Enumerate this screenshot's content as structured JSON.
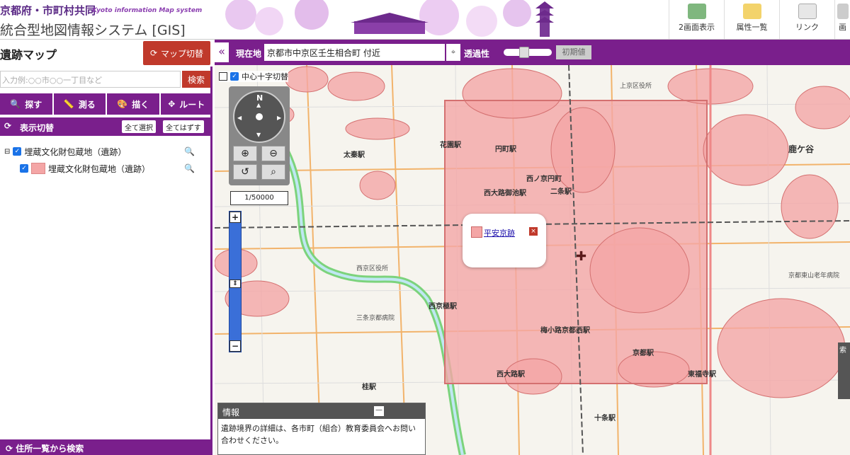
{
  "header": {
    "org": "京都府・市町村共同",
    "org_en": "Kyoto information Map system",
    "system_title": "統合型地図情報システム [GIS]",
    "buttons": [
      {
        "label": "2画面表示",
        "icon": "split-screen-icon"
      },
      {
        "label": "属性一覧",
        "icon": "document-list-icon"
      },
      {
        "label": "リンク",
        "icon": "link-envelope-icon"
      },
      {
        "label": "画",
        "icon": "print-icon"
      }
    ]
  },
  "left_panel": {
    "title": "遺跡マップ",
    "map_switch_label": "マップ切替",
    "search_placeholder": "入力例:○○市○○一丁目など",
    "search_button": "検索",
    "tools": [
      {
        "label": "探す",
        "icon": "search-icon"
      },
      {
        "label": "測る",
        "icon": "ruler-icon"
      },
      {
        "label": "描く",
        "icon": "palette-icon"
      },
      {
        "label": "ルート",
        "icon": "route-icon"
      }
    ],
    "display_switch": {
      "title": "表示切替",
      "select_all": "全て選択",
      "deselect_all": "全てはずす"
    },
    "layers": {
      "parent": "埋蔵文化財包蔵地（遺跡）",
      "child": "埋蔵文化財包蔵地（遺跡）"
    },
    "bottom_bar": "住所一覧から検索"
  },
  "map_bar": {
    "collapse": "«",
    "current_label": "現在地",
    "current_value": "京都市中京区壬生相合町 付近",
    "transparency_label": "透過性",
    "transparency": 0.4,
    "reset_button": "初期値"
  },
  "map": {
    "crosshair_label": "中心十字切替",
    "compass_n": "N",
    "scale": "1/50000",
    "labels": [
      {
        "text": "花園駅"
      },
      {
        "text": "円町駅"
      },
      {
        "text": "太秦駅"
      },
      {
        "text": "西ノ京円町"
      },
      {
        "text": "二条駅"
      },
      {
        "text": "西大路御池駅"
      },
      {
        "text": "西京極駅"
      },
      {
        "text": "梅小路京都西駅"
      },
      {
        "text": "京都駅"
      },
      {
        "text": "西大路駅"
      },
      {
        "text": "東福寺駅"
      },
      {
        "text": "十条駅"
      },
      {
        "text": "桂駅"
      },
      {
        "text": "鹿ケ谷"
      },
      {
        "text": "西京区役所"
      },
      {
        "text": "三条京都病院"
      },
      {
        "text": "上京区役所"
      },
      {
        "text": "京都東山老年病院"
      }
    ],
    "popup": {
      "link": "平安京跡",
      "close": "×"
    },
    "info": {
      "title": "情報",
      "minimize": "—",
      "body": "遺跡境界の詳細は、各市町（組合）教育委員会へお問い合わせください。"
    },
    "right_tab": "索"
  },
  "colors": {
    "purple": "#7a1f8c",
    "red_button": "#c0392b",
    "site_fill": "#f4a6a6"
  }
}
